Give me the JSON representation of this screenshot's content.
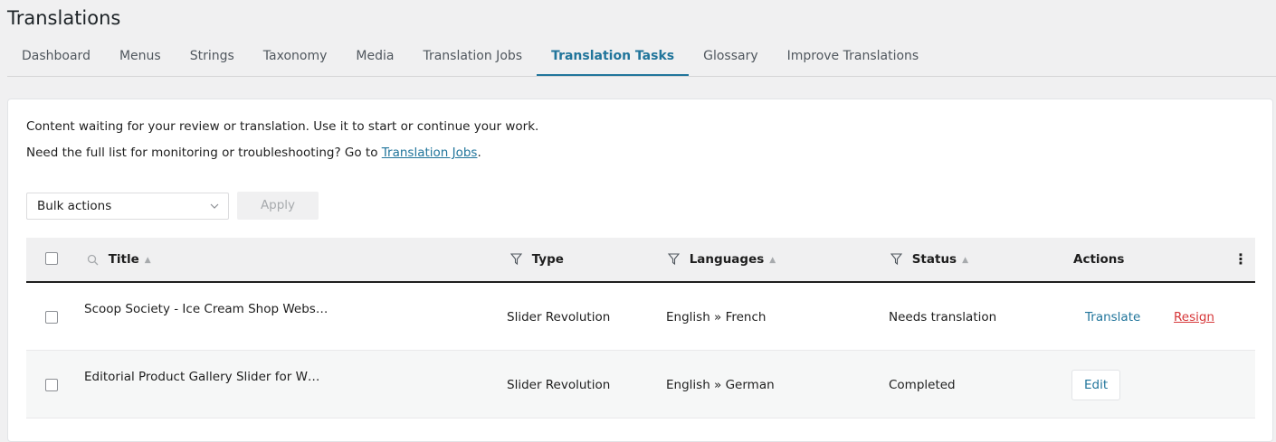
{
  "page": {
    "title": "Translations"
  },
  "tabs": [
    {
      "label": "Dashboard"
    },
    {
      "label": "Menus"
    },
    {
      "label": "Strings"
    },
    {
      "label": "Taxonomy"
    },
    {
      "label": "Media"
    },
    {
      "label": "Translation Jobs"
    },
    {
      "label": "Translation Tasks",
      "active": true
    },
    {
      "label": "Glossary"
    },
    {
      "label": "Improve Translations"
    }
  ],
  "intro": {
    "line1": "Content waiting for your review or translation. Use it to start or continue your work.",
    "line2_prefix": "Need the full list for monitoring or troubleshooting? Go to ",
    "line2_link": "Translation Jobs",
    "line2_suffix": "."
  },
  "toolbar": {
    "bulk_actions": "Bulk actions",
    "apply": "Apply"
  },
  "table": {
    "headers": {
      "title": "Title",
      "type": "Type",
      "languages": "Languages",
      "status": "Status",
      "actions": "Actions"
    },
    "rows": [
      {
        "title": "Scoop Society - Ice Cream Shop Webs…",
        "type": "Slider Revolution",
        "languages": "English » French",
        "status": "Needs translation",
        "action_primary": "Translate",
        "action_secondary": "Resign"
      },
      {
        "title": "Editorial Product Gallery Slider for W…",
        "type": "Slider Revolution",
        "languages": "English » German",
        "status": "Completed",
        "action_primary": "Edit"
      }
    ]
  },
  "colors": {
    "accent": "#21759b",
    "danger": "#d63638"
  }
}
